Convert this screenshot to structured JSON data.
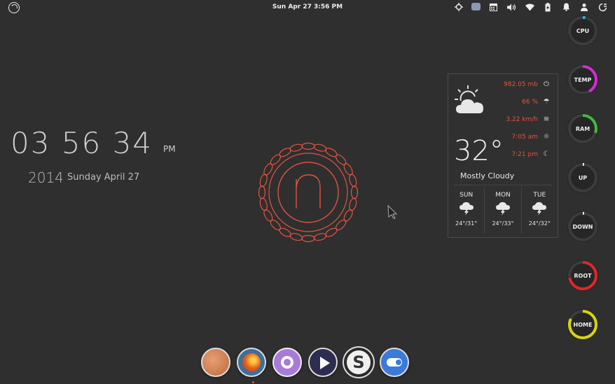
{
  "panel": {
    "clock": "Sun Apr 27  3:56 PM",
    "indicators": [
      "network-icon",
      "keyboard-icon",
      "calendar-icon",
      "volume-icon",
      "wifi-icon",
      "battery-icon",
      "notification-icon",
      "user-icon",
      "session-icon"
    ]
  },
  "desktop_clock": {
    "time": "03 56 34",
    "ampm": "PM",
    "year": "2014",
    "date": "Sunday April 27"
  },
  "weather": {
    "pressure": "982.05 mb",
    "humidity": "66 %",
    "wind": "3.22 km/h",
    "sunrise": "7:05 am",
    "sunset": "7:21 pm",
    "temperature": "32°",
    "condition": "Mostly Cloudy",
    "forecast": [
      {
        "day": "SUN",
        "range": "24°/31°"
      },
      {
        "day": "MON",
        "range": "24°/33°"
      },
      {
        "day": "TUE",
        "range": "24°/32°"
      }
    ],
    "accent": "#e0543e"
  },
  "monitors": [
    {
      "label": "CPU",
      "value": 0.03,
      "color": "#29b6e6"
    },
    {
      "label": "TEMP",
      "value": 0.42,
      "color": "#d42bd6"
    },
    {
      "label": "RAM",
      "value": 0.3,
      "color": "#45b63f"
    },
    {
      "label": "UP",
      "value": 0.0,
      "color": "#ffffff"
    },
    {
      "label": "DOWN",
      "value": 0.0,
      "color": "#ffffff"
    },
    {
      "label": "ROOT",
      "value": 0.72,
      "color": "#e0262a"
    },
    {
      "label": "HOME",
      "value": 0.82,
      "color": "#d8d40f"
    }
  ],
  "dock": [
    "eog-viewer",
    "firefox",
    "sound-recorder",
    "video-player",
    "scratch-app",
    "settings-toggle"
  ]
}
